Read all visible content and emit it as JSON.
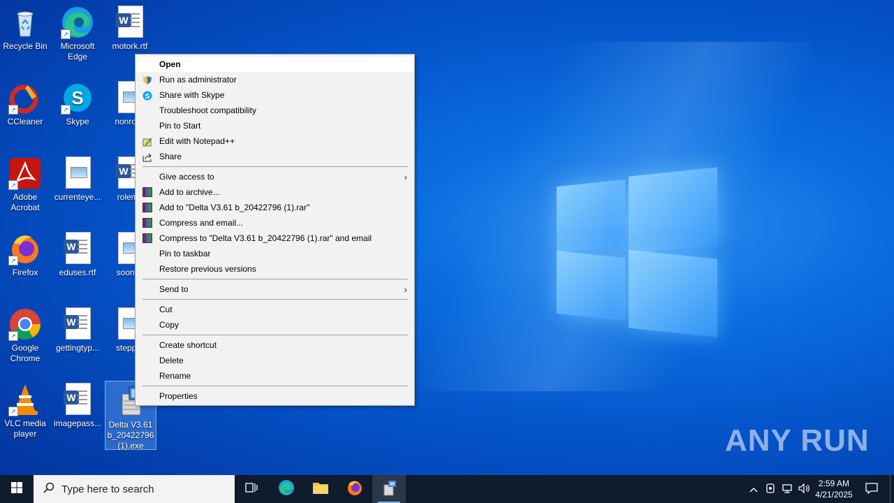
{
  "desktop": {
    "icons": [
      {
        "label": "Recycle Bin"
      },
      {
        "label": "Microsoft Edge"
      },
      {
        "label": "motork.rtf"
      },
      {
        "label": "CCleaner"
      },
      {
        "label": "Skype"
      },
      {
        "label": "nonroya"
      },
      {
        "label": "Adobe Acrobat"
      },
      {
        "label": "currenteye..."
      },
      {
        "label": "rolema"
      },
      {
        "label": "Firefox"
      },
      {
        "label": "eduses.rtf"
      },
      {
        "label": "soonint"
      },
      {
        "label": "Google Chrome"
      },
      {
        "label": "gettingtyp..."
      },
      {
        "label": "steppro"
      },
      {
        "label": "VLC media player"
      },
      {
        "label": "imagepass..."
      },
      {
        "label": "Delta V3.61 b_20422796 (1).exe"
      }
    ]
  },
  "context_menu": {
    "items": [
      {
        "label": "Open"
      },
      {
        "label": "Run as administrator"
      },
      {
        "label": "Share with Skype"
      },
      {
        "label": "Troubleshoot compatibility"
      },
      {
        "label": "Pin to Start"
      },
      {
        "label": "Edit with Notepad++"
      },
      {
        "label": "Share"
      },
      {
        "label": "Give access to"
      },
      {
        "label": "Add to archive..."
      },
      {
        "label": "Add to \"Delta V3.61 b_20422796 (1).rar\""
      },
      {
        "label": "Compress and email..."
      },
      {
        "label": "Compress to \"Delta V3.61 b_20422796 (1).rar\" and email"
      },
      {
        "label": "Pin to taskbar"
      },
      {
        "label": "Restore previous versions"
      },
      {
        "label": "Send to"
      },
      {
        "label": "Cut"
      },
      {
        "label": "Copy"
      },
      {
        "label": "Create shortcut"
      },
      {
        "label": "Delete"
      },
      {
        "label": "Rename"
      },
      {
        "label": "Properties"
      }
    ]
  },
  "taskbar": {
    "search_placeholder": "Type here to search",
    "time": "2:59 AM",
    "date": "4/21/2025"
  },
  "watermark": "ANY RUN",
  "colors": {
    "taskbar": "#0f1c2e",
    "menu_bg": "#f2f2f2",
    "desktop_accent": "#0a6fe0"
  }
}
